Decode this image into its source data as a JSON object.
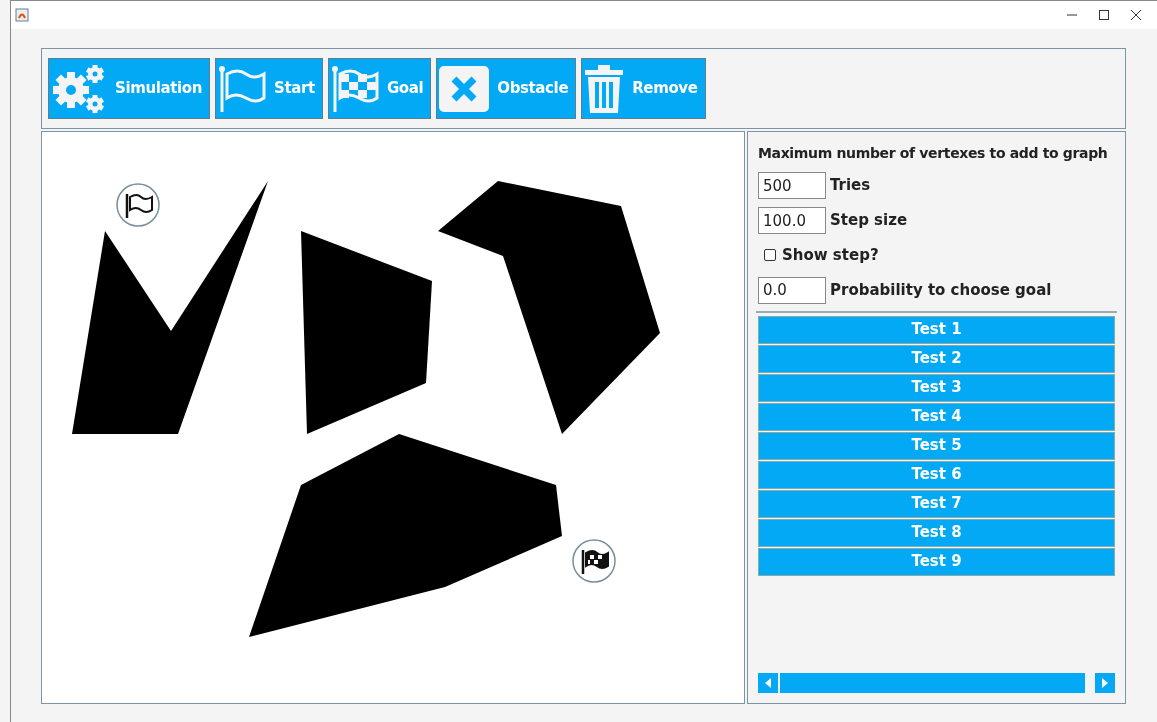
{
  "toolbar": [
    {
      "kind": "gears",
      "label": "Simulation"
    },
    {
      "kind": "flag",
      "label": "Start"
    },
    {
      "kind": "checkered",
      "label": "Goal"
    },
    {
      "kind": "cross",
      "label": "Obstacle"
    },
    {
      "kind": "trash",
      "label": "Remove"
    }
  ],
  "settings": {
    "heading": "Maximum number of vertexes to add to graph",
    "fields": [
      {
        "value": "500",
        "label": "Tries"
      },
      {
        "value": "100.0",
        "label": "Step size"
      }
    ],
    "checkbox": {
      "label": "Show step?",
      "checked": false
    },
    "goal_field": {
      "value": "0.0",
      "label": "Probability to choose goal"
    }
  },
  "tests": [
    "Test 1",
    "Test 2",
    "Test 3",
    "Test 4",
    "Test 5",
    "Test 6",
    "Test 7",
    "Test 8",
    "Test 9"
  ]
}
